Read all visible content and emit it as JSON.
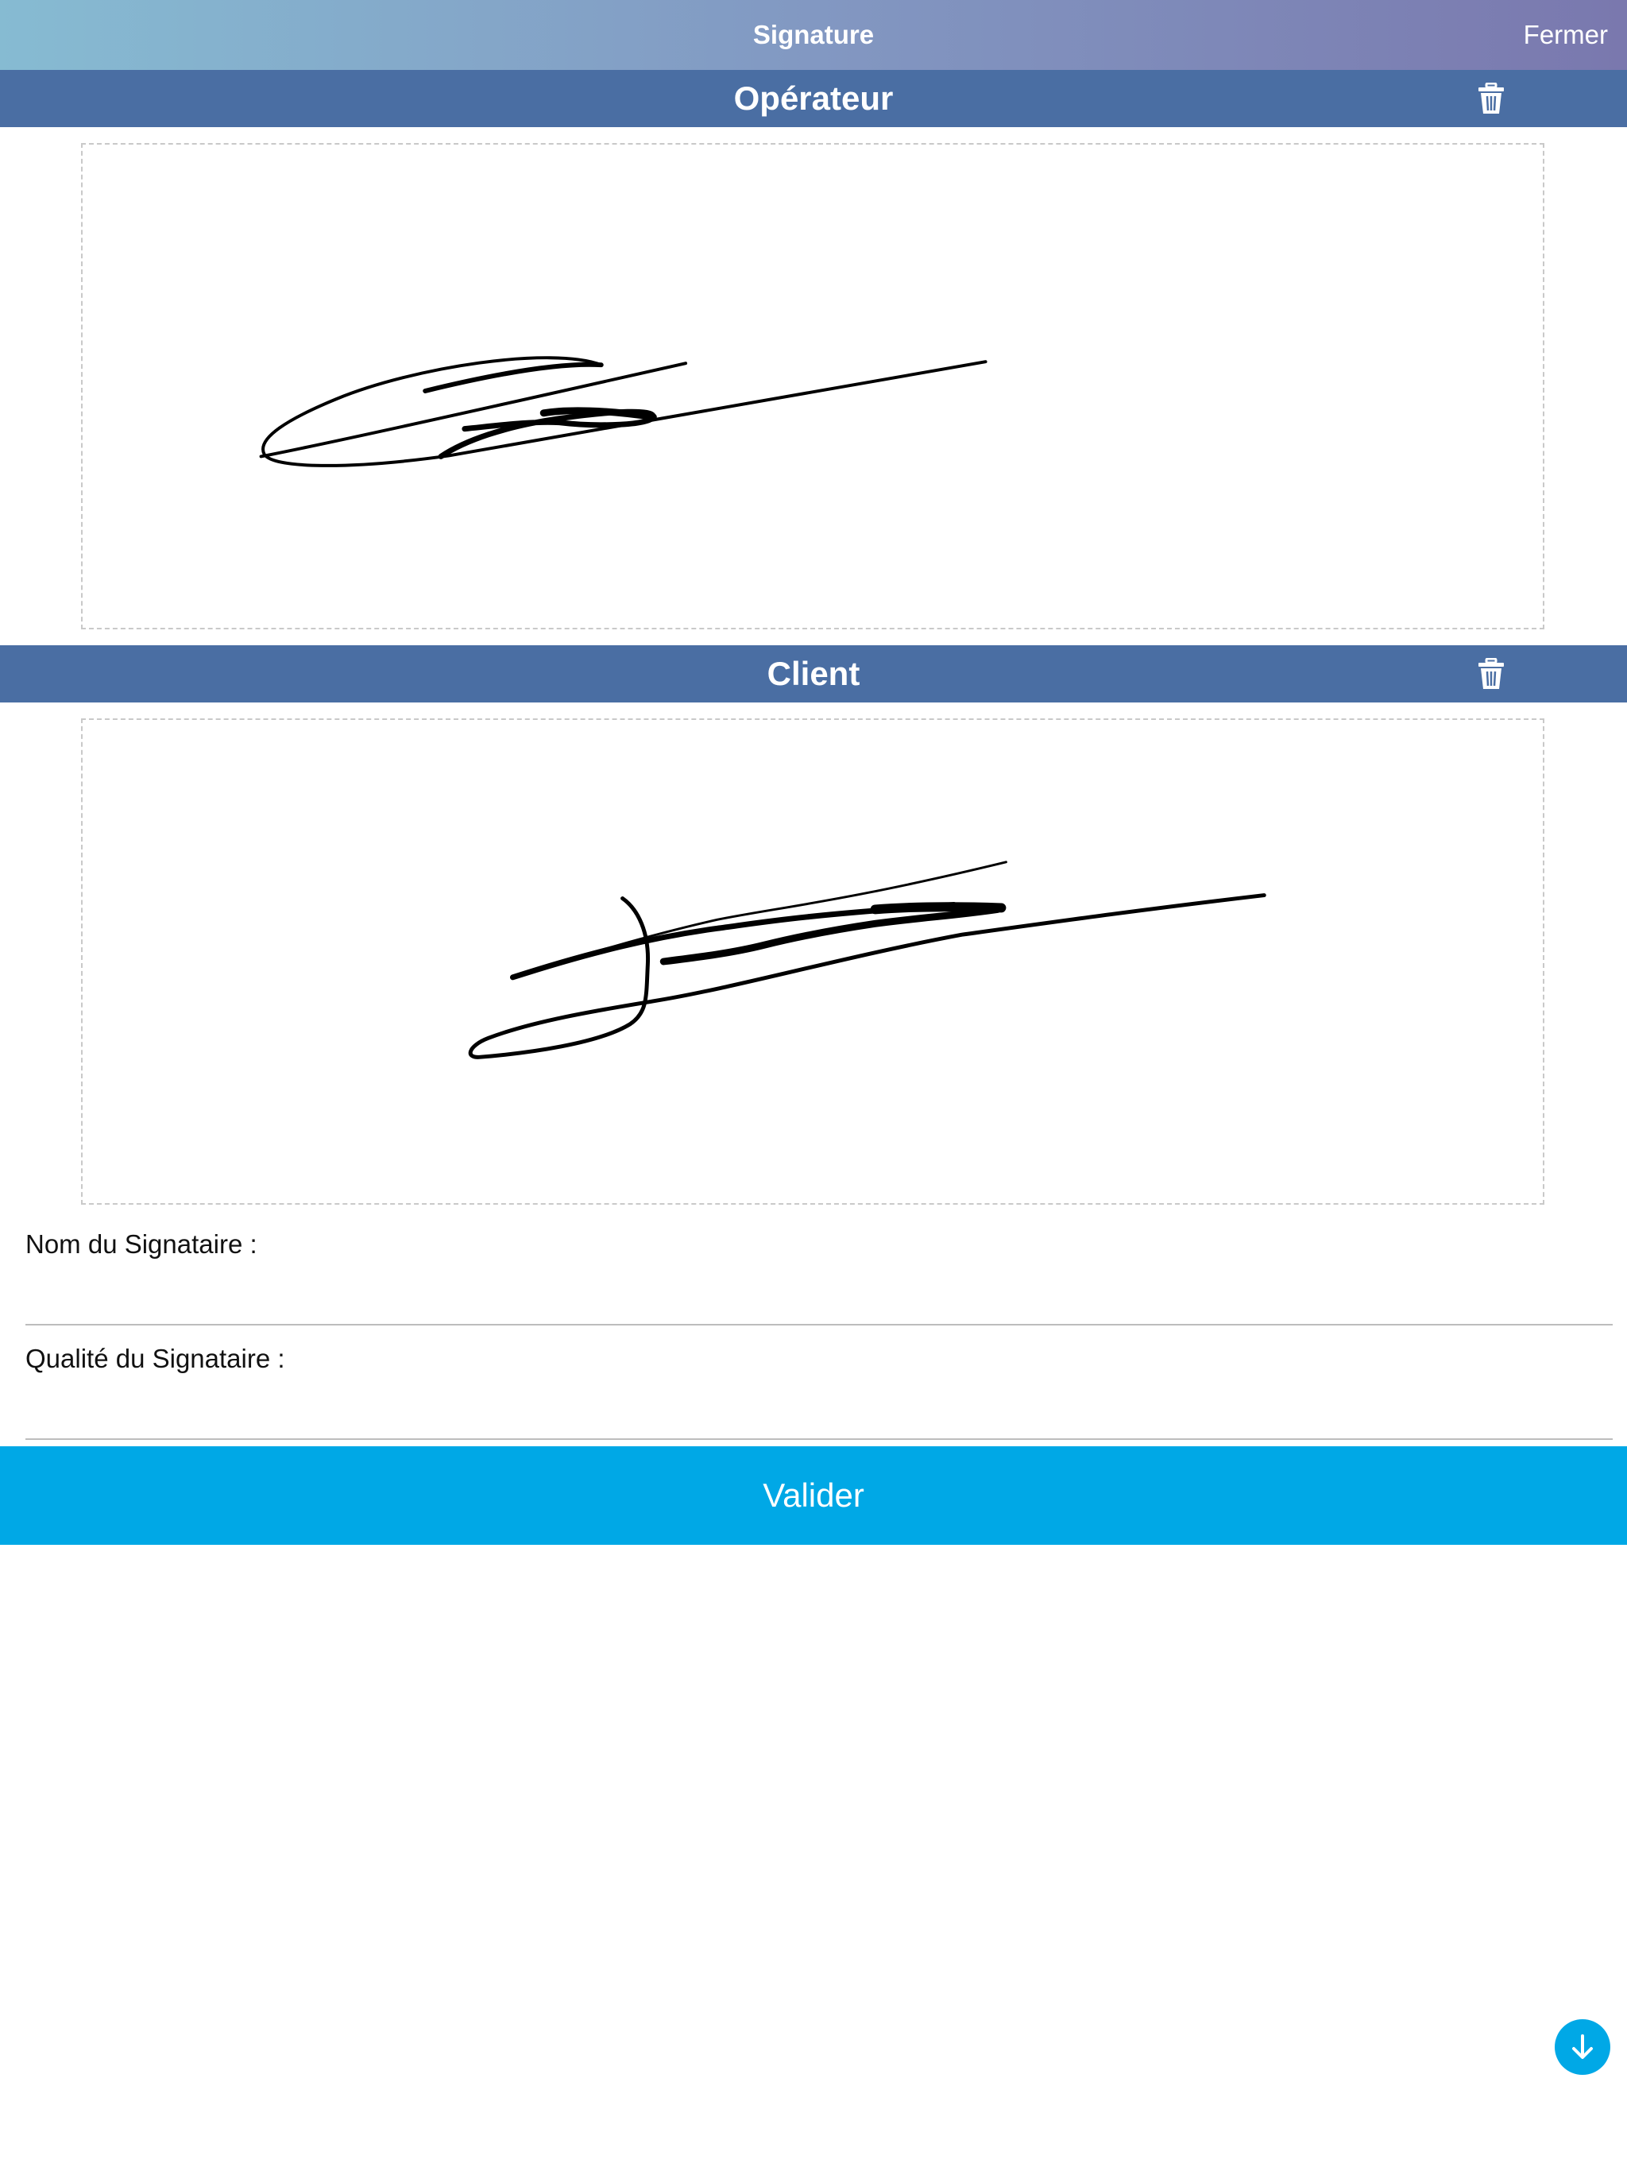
{
  "header": {
    "title": "Signature",
    "close_label": "Fermer"
  },
  "sections": [
    {
      "label": "Opérateur",
      "clear_icon": "trash-icon"
    },
    {
      "label": "Client",
      "clear_icon": "trash-icon"
    }
  ],
  "form": {
    "signer_name_label": "Nom du Signataire :",
    "signer_name_value": "",
    "signer_quality_label": "Qualité du Signataire :",
    "signer_quality_value": ""
  },
  "actions": {
    "validate_label": "Valider",
    "scroll_icon": "arrow-down-circle-icon"
  },
  "colors": {
    "section_header": "#4a6ea3",
    "accent": "#00a8e6"
  }
}
